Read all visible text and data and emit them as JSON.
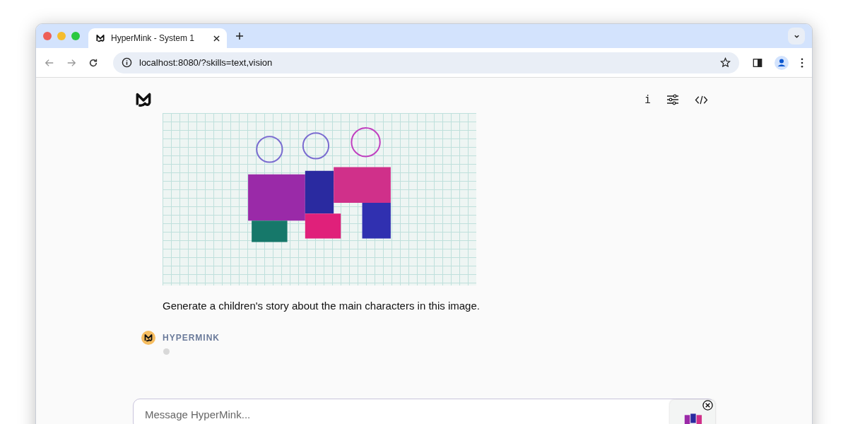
{
  "browser": {
    "tab": {
      "title": "HyperMink - System 1",
      "selected": true
    },
    "url": "localhost:8080/?skills=text,vision"
  },
  "header": {
    "info_label": "i"
  },
  "conversation": {
    "user_message": "Generate a children's story about the main characters in this image.",
    "assistant": {
      "name": "HYPERMINK"
    }
  },
  "composer": {
    "placeholder": "Message HyperMink..."
  }
}
